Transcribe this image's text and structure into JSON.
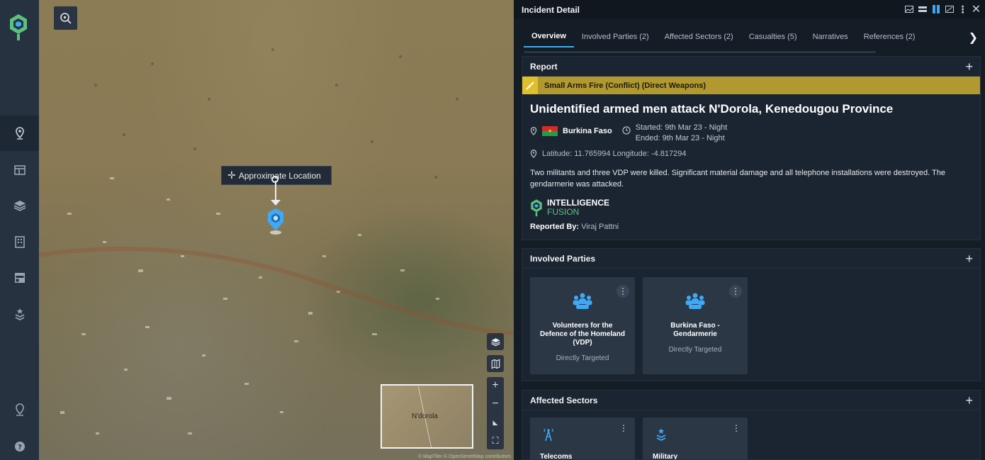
{
  "map": {
    "approx_location_label": "Approximate Location",
    "minimap_label": "N'dorola",
    "attribution": "© MapTiler © OpenStreetMap contributors"
  },
  "panel": {
    "title": "Incident Detail",
    "tabs": [
      {
        "label": "Overview"
      },
      {
        "label": "Involved Parties (2)"
      },
      {
        "label": "Affected Sectors (2)"
      },
      {
        "label": "Casualties (5)"
      },
      {
        "label": "Narratives"
      },
      {
        "label": "References (2)"
      }
    ]
  },
  "report": {
    "section_title": "Report",
    "category": "Small Arms Fire (Conflict) (Direct Weapons)",
    "title": "Unidentified armed men attack N'Dorola, Kenedougou Province",
    "country": "Burkina Faso",
    "started": "Started: 9th Mar 23 - Night",
    "ended": "Ended: 9th Mar 23 - Night",
    "coordinates": "Latitude: 11.765994 Longitude: -4.817294",
    "description": "Two militants and three VDP were killed. Significant material damage and all telephone installations were destroyed. The gendarmerie was attacked.",
    "source_name": "INTELLIGENCE",
    "source_sub": "FUSION",
    "reported_by_label": "Reported By:",
    "reported_by": "Viraj Pattni"
  },
  "involved_parties": {
    "section_title": "Involved Parties",
    "items": [
      {
        "name": "Volunteers for the Defence of the Homeland (VDP)",
        "role": "Directly Targeted"
      },
      {
        "name": "Burkina Faso - Gendarmerie",
        "role": "Directly Targeted"
      }
    ]
  },
  "affected_sectors": {
    "section_title": "Affected Sectors",
    "items": [
      {
        "name": "Telecoms"
      },
      {
        "name": "Military"
      }
    ]
  },
  "colors": {
    "accent": "#3fa9f5",
    "category_band": "#b19930",
    "brand_green": "#5bc17f"
  }
}
